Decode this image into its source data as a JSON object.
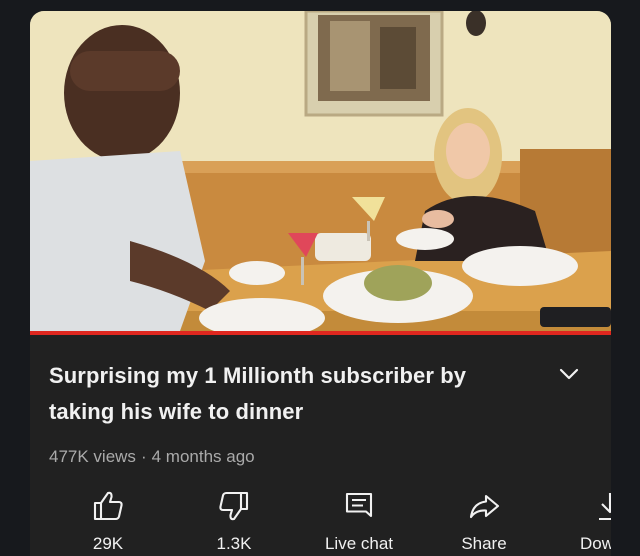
{
  "video": {
    "title": "Surprising my 1 Millionth subscriber by taking his wife to dinner",
    "views": "477K views",
    "separator": "·",
    "age": "4 months ago",
    "progress": 1.0
  },
  "actions": {
    "like": {
      "label": "29K",
      "icon": "thumbs-up-icon"
    },
    "dislike": {
      "label": "1.3K",
      "icon": "thumbs-down-icon"
    },
    "live_chat": {
      "label": "Live chat",
      "icon": "chat-icon"
    },
    "share": {
      "label": "Share",
      "icon": "share-arrow-icon"
    },
    "download": {
      "label": "Down",
      "icon": "download-icon"
    }
  },
  "colors": {
    "background": "#212121",
    "progress_red": "#e0271f",
    "primary_text": "#f1f1f1",
    "secondary_text": "#aaaaaa"
  }
}
